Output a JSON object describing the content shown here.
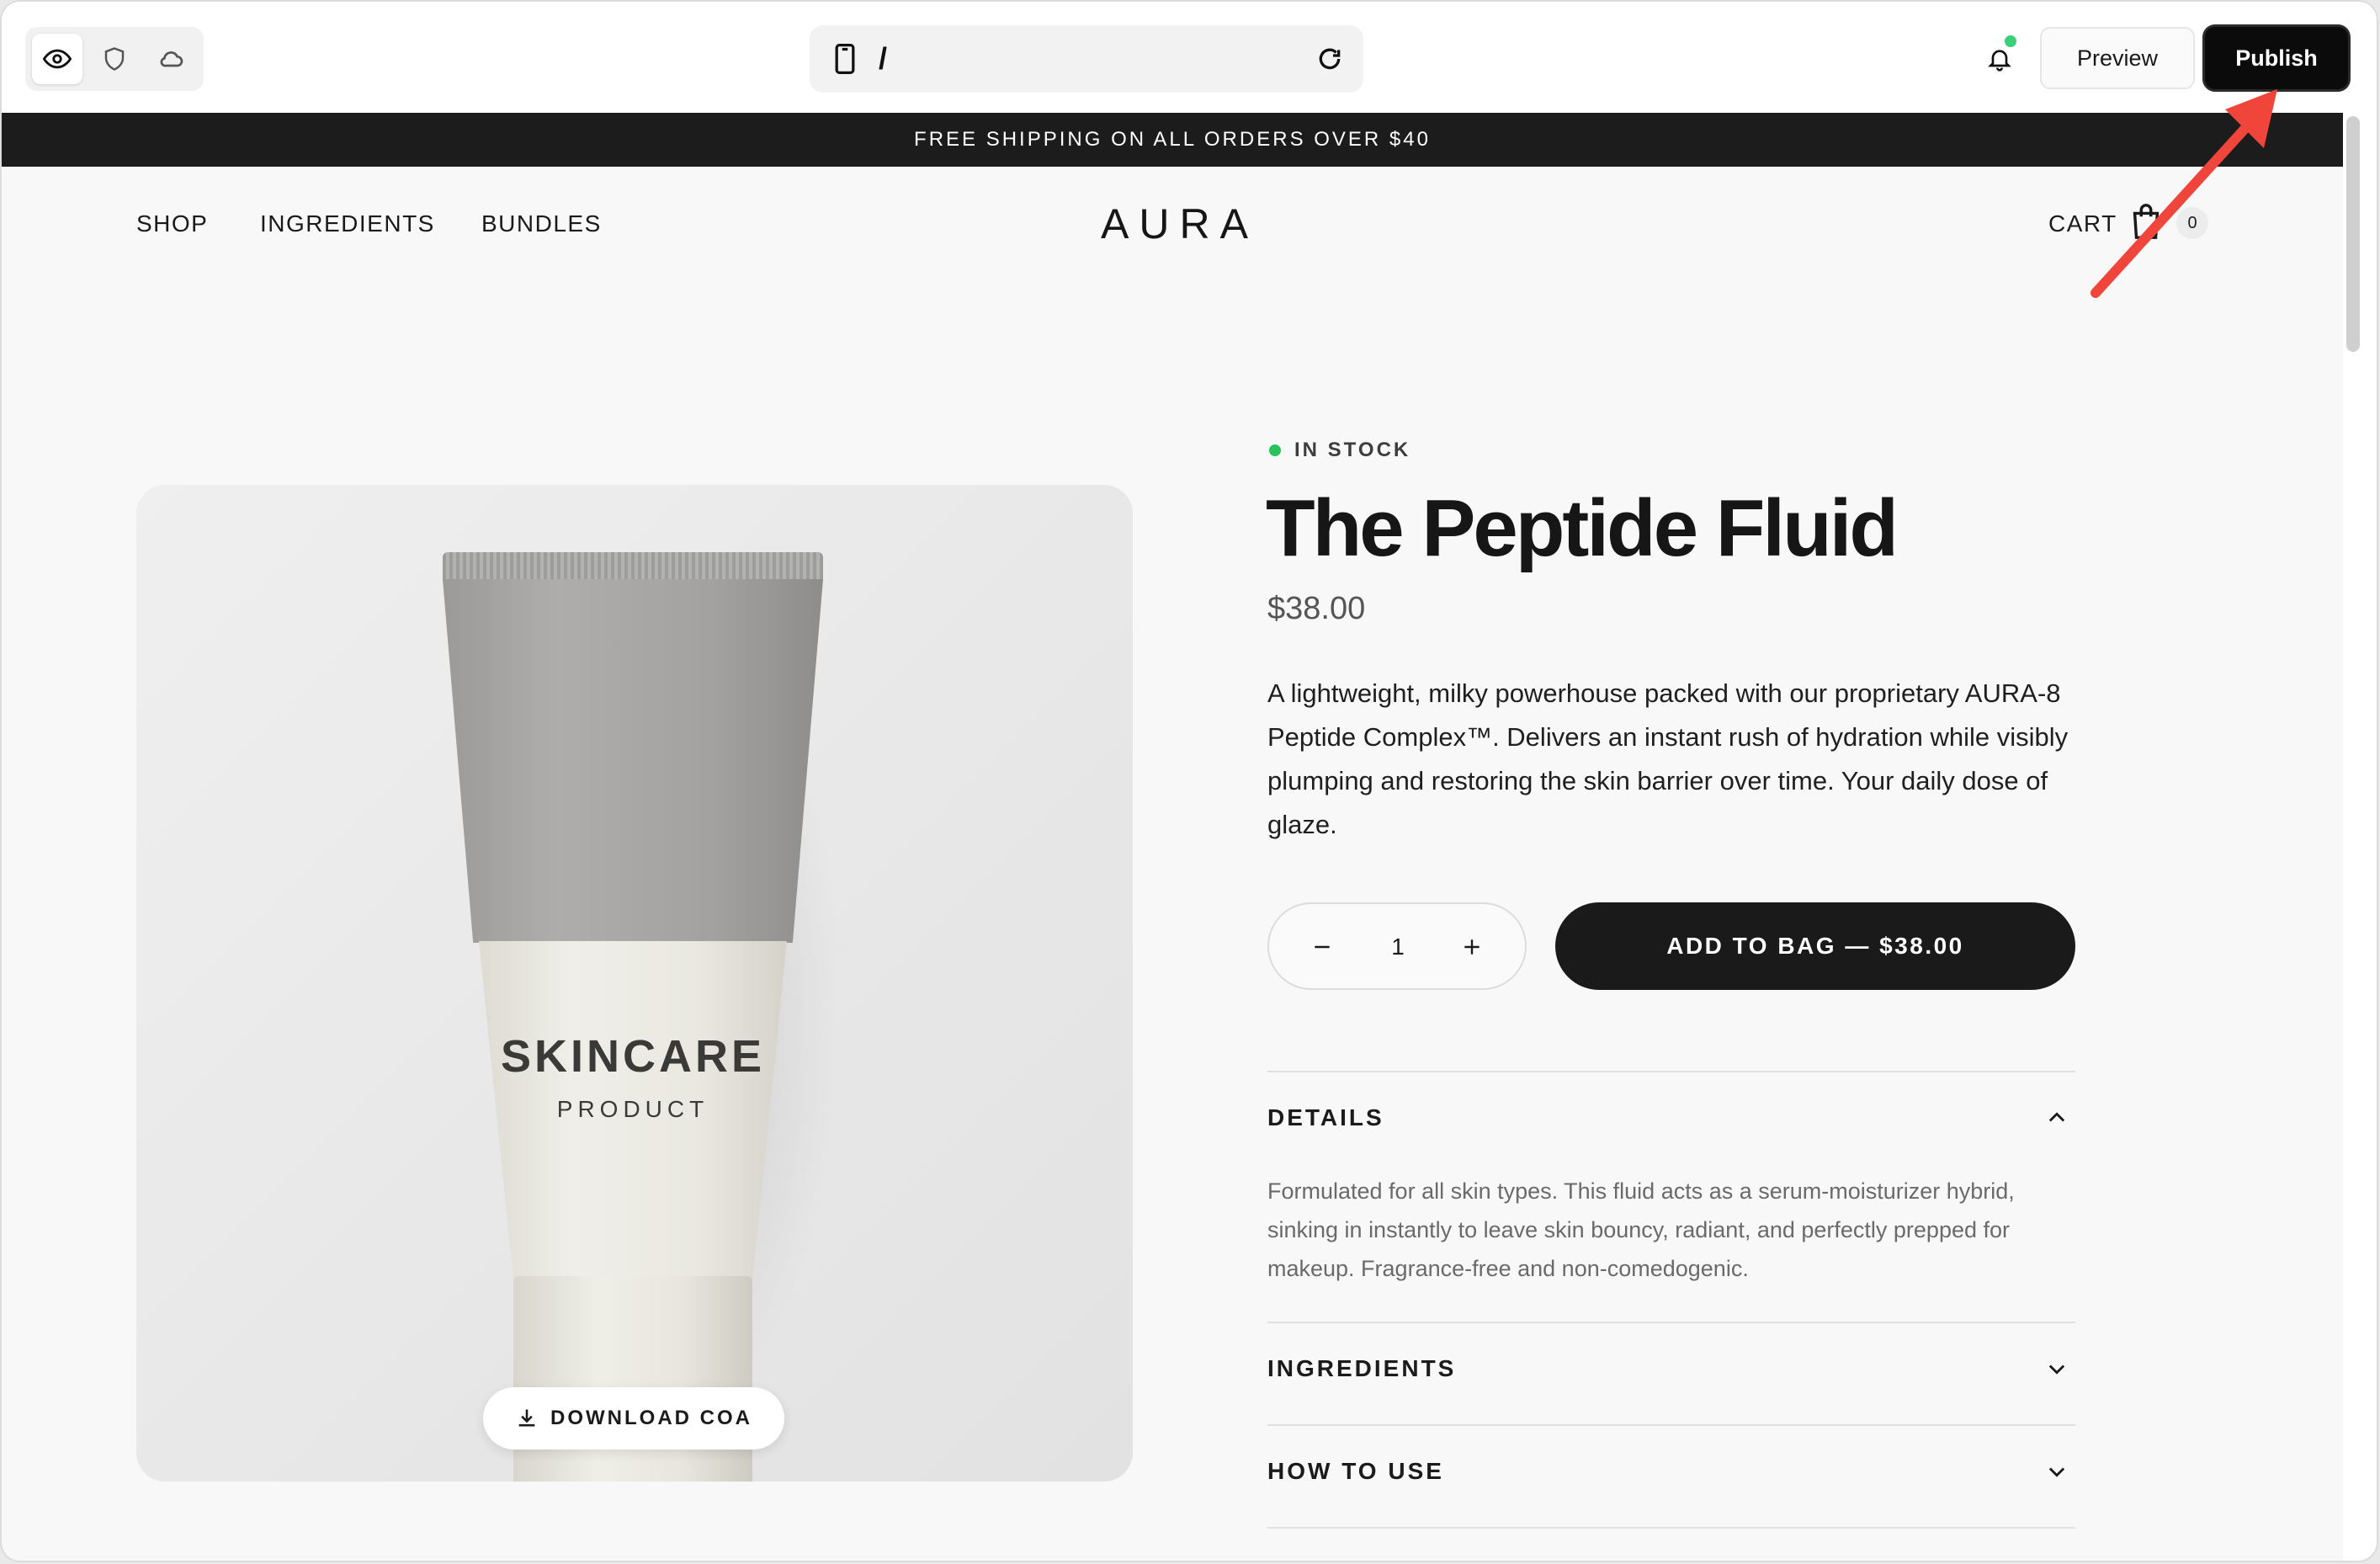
{
  "builder": {
    "view_modes": [
      "eye-icon",
      "shield-icon",
      "cloud-icon"
    ],
    "url": {
      "device_icon": "phone-icon",
      "path": "/",
      "refresh_icon": "refresh-icon"
    },
    "notification_dot_color": "#3ccf7a",
    "preview_label": "Preview",
    "publish_label": "Publish"
  },
  "store": {
    "announcement": "FREE SHIPPING ON ALL ORDERS OVER $40",
    "nav": [
      "SHOP",
      "INGREDIENTS",
      "BUNDLES"
    ],
    "logo": "AURA",
    "cart_label": "CART",
    "cart_count": "0"
  },
  "product": {
    "image_text_line1": "SKINCARE",
    "image_text_line2": "PRODUCT",
    "download_label": "DOWNLOAD COA",
    "stock": "IN STOCK",
    "stock_color": "#28c45b",
    "title": "The Peptide Fluid",
    "price": "$38.00",
    "description": "A lightweight, milky powerhouse packed with our proprietary AURA-8 Peptide Complex™. Delivers an instant rush of hydration while visibly plumping and restoring the skin barrier over time. Your daily dose of glaze.",
    "quantity": "1",
    "add_to_bag": "ADD TO BAG — $38.00",
    "accordion": [
      {
        "title": "DETAILS",
        "expanded": true,
        "body": "Formulated for all skin types. This fluid acts as a serum-moisturizer hybrid, sinking in instantly to leave skin bouncy, radiant, and perfectly prepped for makeup. Fragrance-free and non-comedogenic."
      },
      {
        "title": "INGREDIENTS",
        "expanded": false
      },
      {
        "title": "HOW TO USE",
        "expanded": false
      }
    ]
  },
  "annotation": {
    "color": "#f0453a",
    "target": "publish-button"
  }
}
